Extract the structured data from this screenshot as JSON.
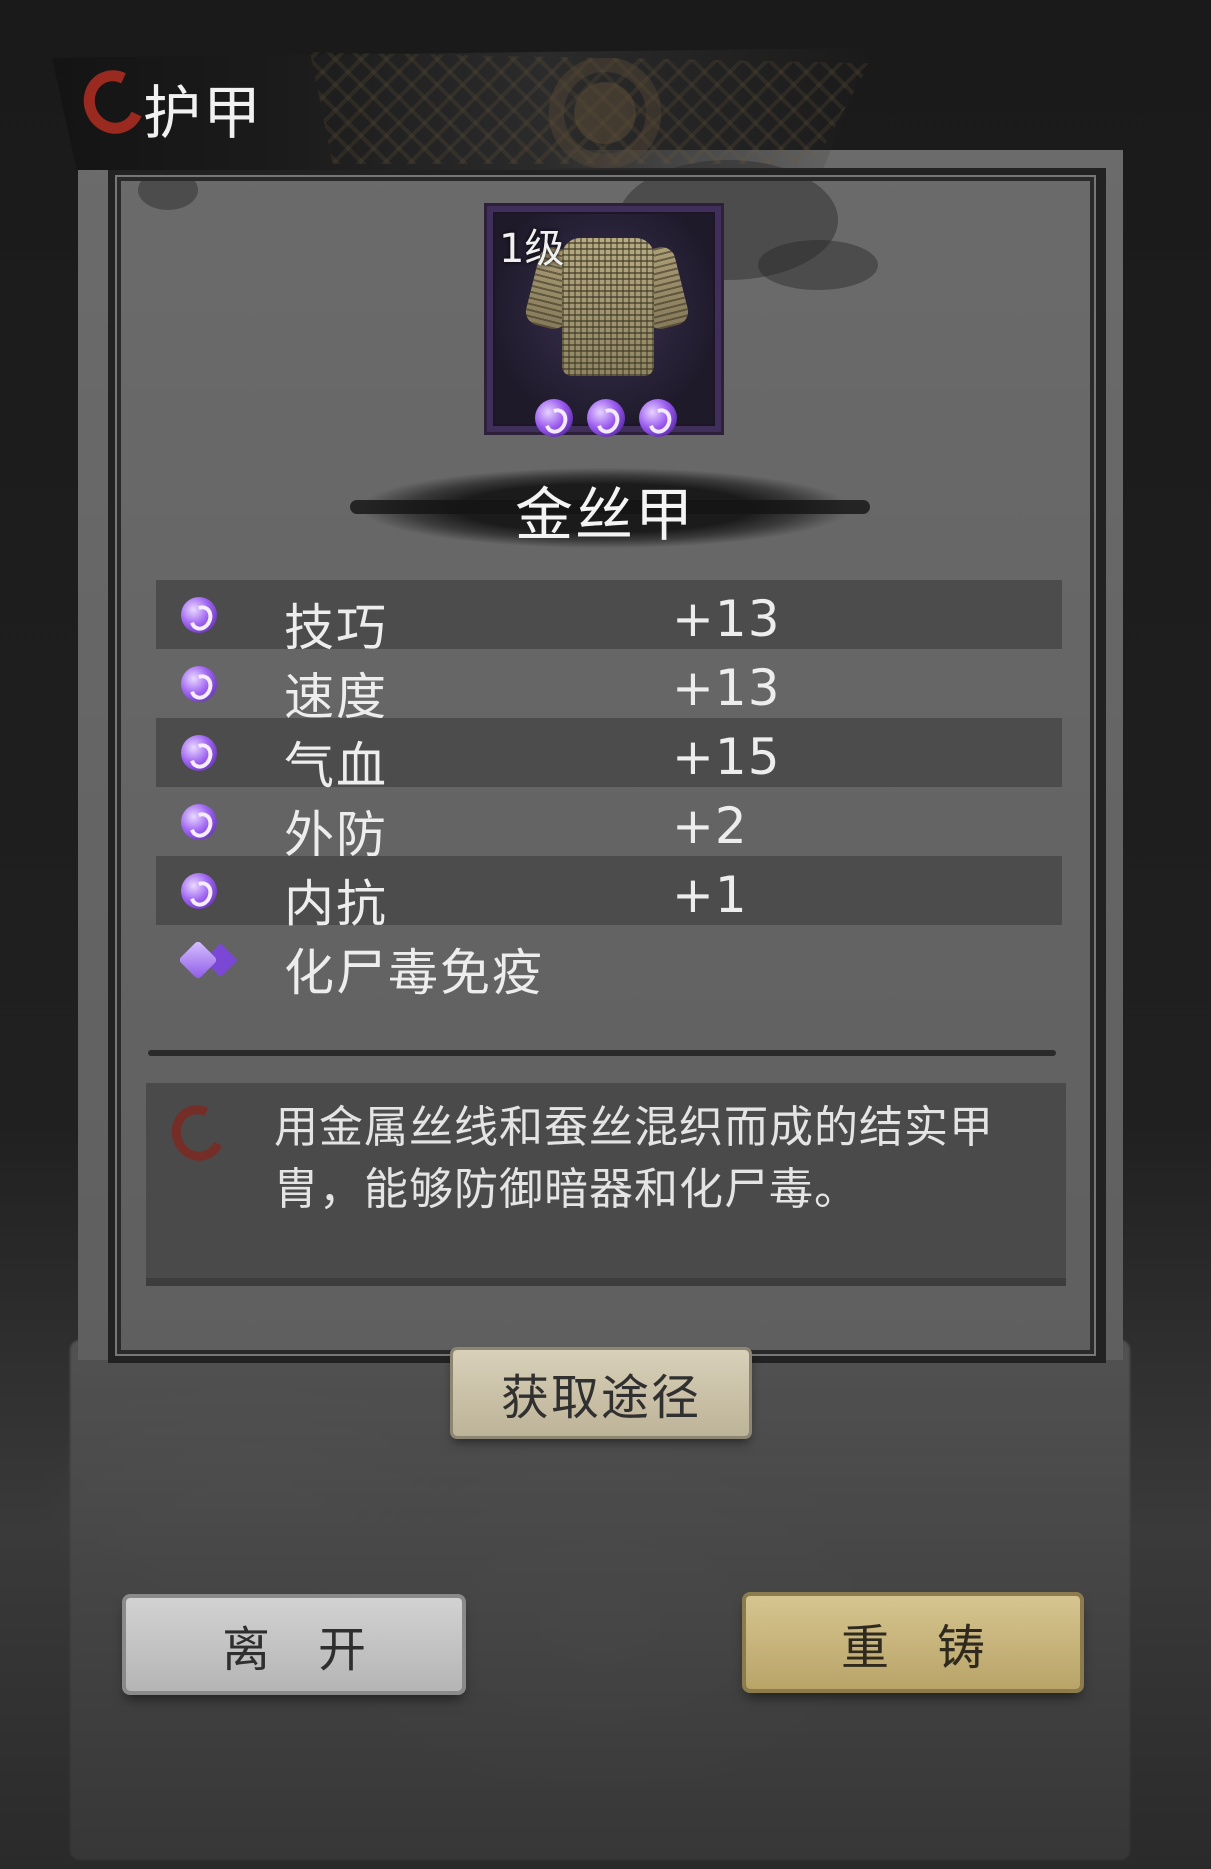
{
  "header": {
    "title": "护甲"
  },
  "item": {
    "level_label": "1级",
    "name": "金丝甲",
    "gem_count": 3
  },
  "stats": [
    {
      "label": "技巧",
      "value": "+13",
      "icon": "purple-gem-icon"
    },
    {
      "label": "速度",
      "value": "+13",
      "icon": "purple-gem-icon"
    },
    {
      "label": "气血",
      "value": "+15",
      "icon": "purple-gem-icon"
    },
    {
      "label": "外防",
      "value": "+2",
      "icon": "purple-gem-icon"
    },
    {
      "label": "内抗",
      "value": "+1",
      "icon": "purple-gem-icon"
    },
    {
      "label": "化尸毒免疫",
      "value": "",
      "icon": "purple-diamond-icon"
    }
  ],
  "description": "用金属丝线和蚕丝混织而成的结实甲胄，能够防御暗器和化尸毒。",
  "buttons": {
    "source": "获取途径",
    "leave_1": "离",
    "leave_2": "开",
    "reforge_1": "重",
    "reforge_2": "铸"
  },
  "colors": {
    "accent_purple": "#9b5cf0",
    "logo_red": "#9a2a20",
    "reforge_gold": "#c9b57a"
  }
}
